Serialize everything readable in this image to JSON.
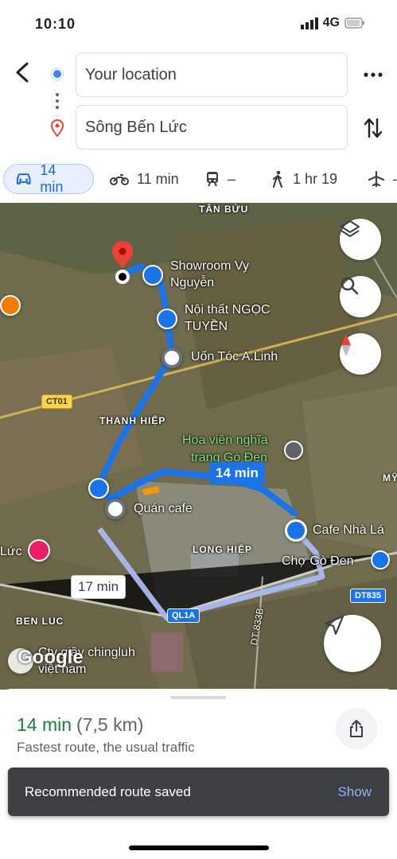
{
  "status_bar": {
    "time": "10:10",
    "network": "4G"
  },
  "search": {
    "origin": "Your location",
    "destination": "Sông Bến Lức"
  },
  "modes": [
    {
      "name": "car",
      "label": "14 min",
      "selected": true
    },
    {
      "name": "motorbike",
      "label": "11 min"
    },
    {
      "name": "transit",
      "label": "–"
    },
    {
      "name": "walk",
      "label": "1 hr 19"
    },
    {
      "name": "flight",
      "label": "–"
    }
  ],
  "map": {
    "places": {
      "tan_buu": "TÂN BỬU",
      "showroom_1": "Showroom Vy",
      "showroom_2": "Nguyễn",
      "noi_that_1": "Nội thất NGỌC",
      "noi_that_2": "TUYỀN",
      "uon_toc": "Uốn Tóc A.Linh",
      "thanh_hiep": "THANH HIỆP",
      "hoa_vien_1": "Hoa viên nghĩa",
      "hoa_vien_2": "trang Gò Đen",
      "quan_cafe": "Quán cafe",
      "cafe_nha_la": "Cafe Nhà Lá",
      "cho_go_den": "Chợ Gò Đen",
      "long_hiep": "LONG HIỆP",
      "ben_luc": "BEN LUC",
      "luc": "Lức",
      "giay_1": "Cty giầy chingluh",
      "giay_2": "việt nam",
      "my": "MỸ"
    },
    "roads": {
      "ct01": "CT01",
      "ql1a": "QL1A",
      "dt835": "DT835",
      "dt833b": "DT 833B"
    },
    "route_time_selected": "14 min",
    "route_time_alt": "17 min",
    "watermark": "Google"
  },
  "sheet": {
    "duration": "14 min",
    "distance": "(7,5 km)",
    "description": "Fastest route, the usual traffic"
  },
  "snackbar": {
    "message": "Recommended route saved",
    "action": "Show"
  },
  "colors": {
    "route": "#1a73e8",
    "alt_route": "#aab9f0",
    "eta_green": "#188038",
    "origin_dot": "#4285f4",
    "destination_pin": "#ea4335"
  }
}
